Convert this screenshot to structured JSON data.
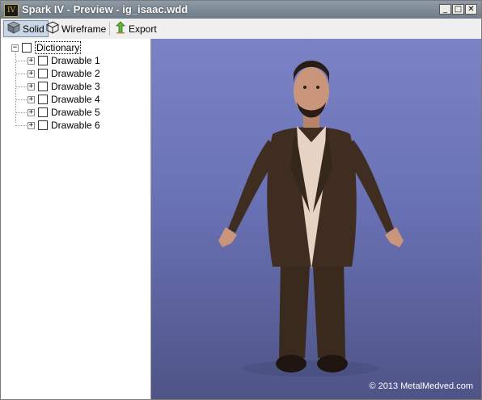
{
  "window": {
    "title": "Spark IV - Preview - ig_isaac.wdd",
    "app_icon_text": "IV",
    "controls": {
      "minimize": "_",
      "maximize": "□",
      "close": "✕"
    }
  },
  "toolbar": {
    "solid_label": "Solid",
    "wireframe_label": "Wireframe",
    "export_label": "Export"
  },
  "tree": {
    "root": {
      "label": "Dictionary",
      "expander": "−"
    },
    "items": [
      {
        "label": "Drawable 1",
        "expander": "+"
      },
      {
        "label": "Drawable 2",
        "expander": "+"
      },
      {
        "label": "Drawable 3",
        "expander": "+"
      },
      {
        "label": "Drawable 4",
        "expander": "+"
      },
      {
        "label": "Drawable 5",
        "expander": "+"
      },
      {
        "label": "Drawable 6",
        "expander": "+"
      }
    ]
  },
  "viewport": {
    "copyright": "© 2013 MetalMedved.com"
  },
  "colors": {
    "titlebar": "#7f8c97",
    "viewport_top": "#7b82c6",
    "viewport_bottom": "#4e5486",
    "suit": "#3e2d20",
    "shirt": "#e6d3c4",
    "skin": "#c9967c"
  }
}
